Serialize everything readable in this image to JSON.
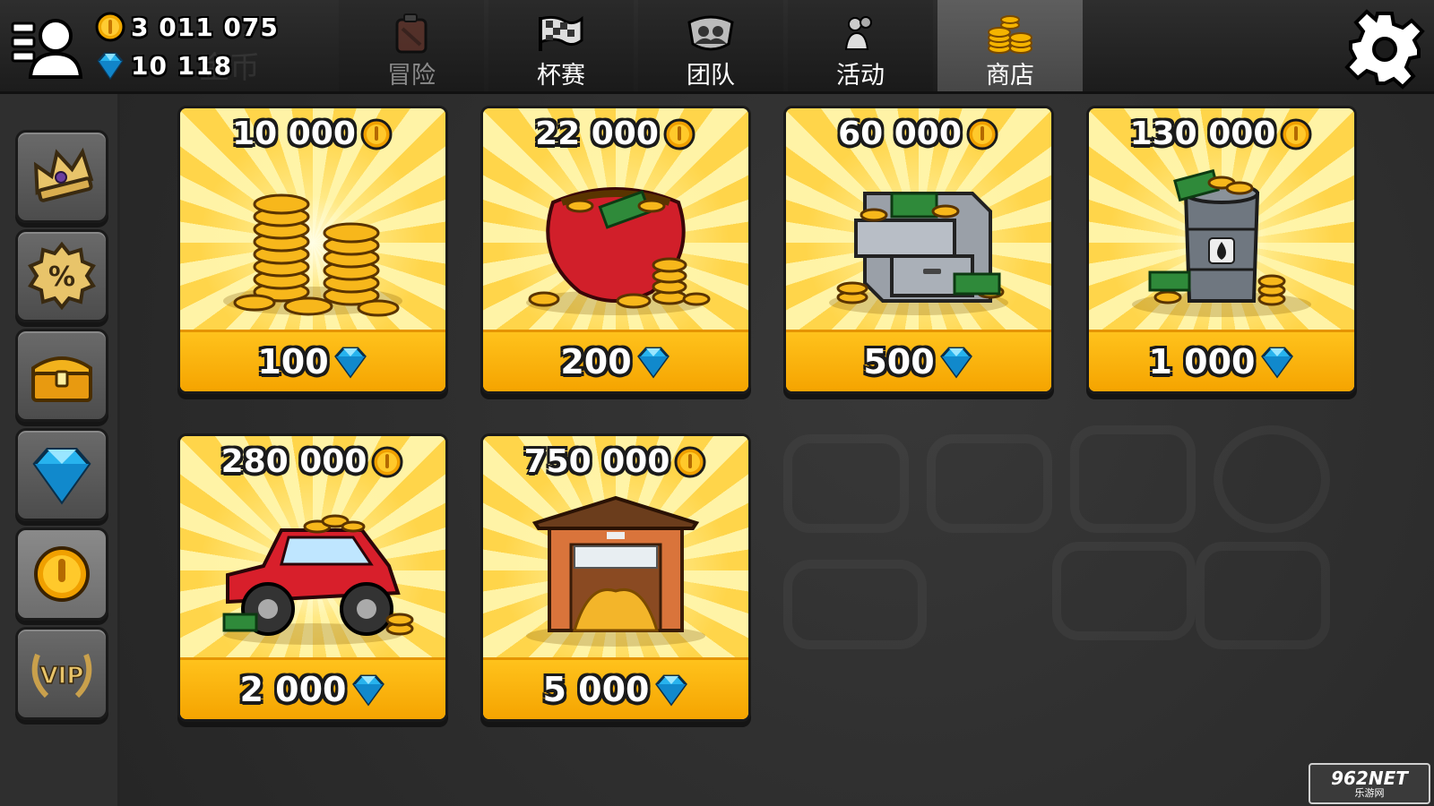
{
  "header": {
    "coins": "3 011 075",
    "gems": "10 118",
    "ghost_label": "金币"
  },
  "tabs": [
    {
      "label": "冒险",
      "icon": "fuel-can-icon",
      "active": false
    },
    {
      "label": "杯赛",
      "icon": "checkered-flag-icon",
      "active": false
    },
    {
      "label": "团队",
      "icon": "team-badge-icon",
      "active": false
    },
    {
      "label": "活动",
      "icon": "event-people-icon",
      "active": false
    },
    {
      "label": "商店",
      "icon": "coin-stack-icon",
      "active": true
    }
  ],
  "sidebar": [
    {
      "icon": "crown-icon"
    },
    {
      "icon": "discount-badge-icon"
    },
    {
      "icon": "treasure-chest-icon"
    },
    {
      "icon": "gem-icon"
    },
    {
      "icon": "coin-icon",
      "active": true
    },
    {
      "icon": "vip-laurel-icon"
    }
  ],
  "offers": [
    {
      "coins": "10 000",
      "gems": "100",
      "art": "coin-piles-icon"
    },
    {
      "coins": "22 000",
      "gems": "200",
      "art": "money-purse-icon"
    },
    {
      "coins": "60 000",
      "gems": "500",
      "art": "filing-cabinet-icon"
    },
    {
      "coins": "130 000",
      "gems": "1 000",
      "art": "oil-barrel-icon"
    },
    {
      "coins": "280 000",
      "gems": "2 000",
      "art": "jeep-icon"
    },
    {
      "coins": "750 000",
      "gems": "5 000",
      "art": "garage-icon"
    }
  ],
  "watermark": {
    "main": "962NET",
    "sub": "乐游网"
  },
  "colors": {
    "card_yellow": "#ffd54a",
    "card_bottom": "#f5a400",
    "coin_gold": "#f0a800",
    "gem_blue": "#1aa3e0",
    "active_tab": "#5a5a5a"
  }
}
